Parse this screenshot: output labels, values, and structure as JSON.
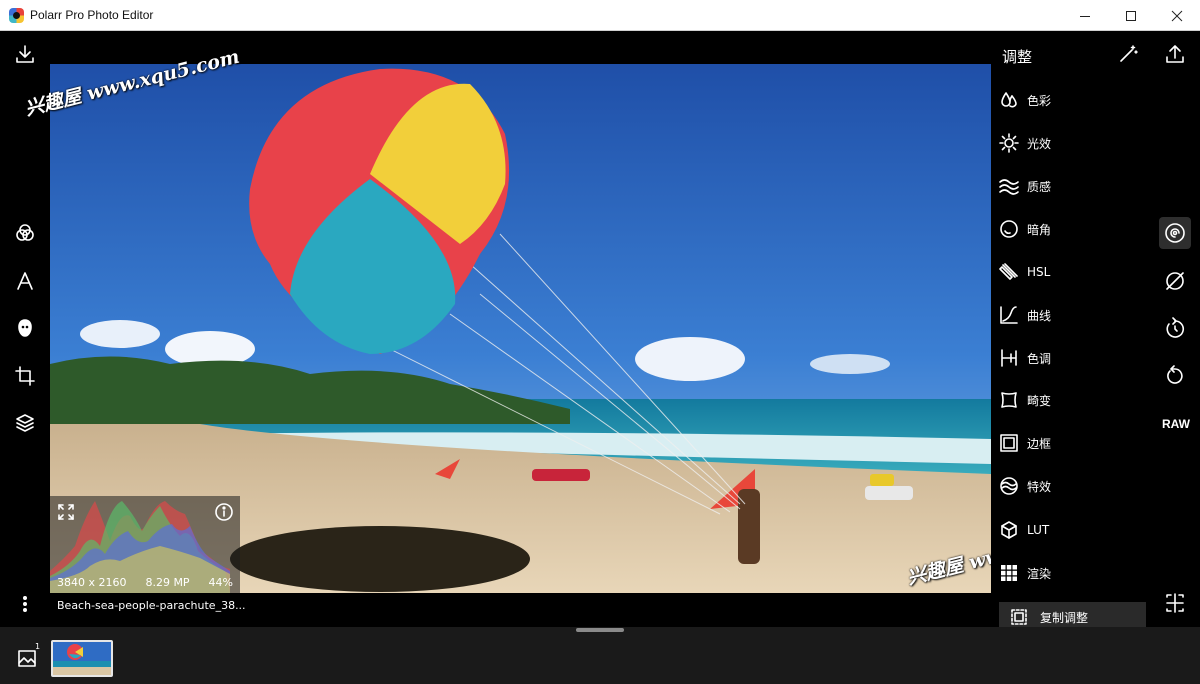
{
  "window": {
    "title": "Polarr Pro Photo Editor",
    "controls": [
      "minimize",
      "maximize",
      "close"
    ]
  },
  "left_toolbar": {
    "top_icon": "download-icon",
    "tools": [
      "filters-icon",
      "text-icon",
      "face-icon",
      "crop-icon",
      "layers-icon"
    ],
    "bottom_icon": "more-vertical-icon"
  },
  "photo": {
    "histogram": {
      "resolution": "3840 x 2160",
      "megapixels": "8.29 MP",
      "zoom": "44%"
    },
    "filename": "Beach-sea-people-parachute_38..."
  },
  "watermark": {
    "text": "兴趣屋 www.xqu5.com"
  },
  "adjust_panel": {
    "title": "调整",
    "items": [
      {
        "label": "色彩",
        "icon": "drops-icon"
      },
      {
        "label": "光效",
        "icon": "sun-icon"
      },
      {
        "label": "质感",
        "icon": "waves-icon"
      },
      {
        "label": "暗角",
        "icon": "vignette-icon"
      },
      {
        "label": "HSL",
        "icon": "brush-icon"
      },
      {
        "label": "曲线",
        "icon": "curve-icon"
      },
      {
        "label": "色调",
        "icon": "toning-icon"
      },
      {
        "label": "畸变",
        "icon": "distortion-icon"
      },
      {
        "label": "边框",
        "icon": "border-icon"
      },
      {
        "label": "特效",
        "icon": "effects-icon"
      },
      {
        "label": "LUT",
        "icon": "cube-icon"
      },
      {
        "label": "渲染",
        "icon": "grid-icon"
      }
    ],
    "copy_button": "复制调整"
  },
  "right_toolbar": {
    "top_icons": [
      "magic-wand-icon",
      "share-icon"
    ],
    "tools": [
      "spiral-icon",
      "compare-icon",
      "undo-history-icon",
      "reset-icon"
    ],
    "raw_label": "RAW",
    "bottom_icon": "split-view-icon"
  },
  "filmstrip": {
    "count": "1"
  }
}
